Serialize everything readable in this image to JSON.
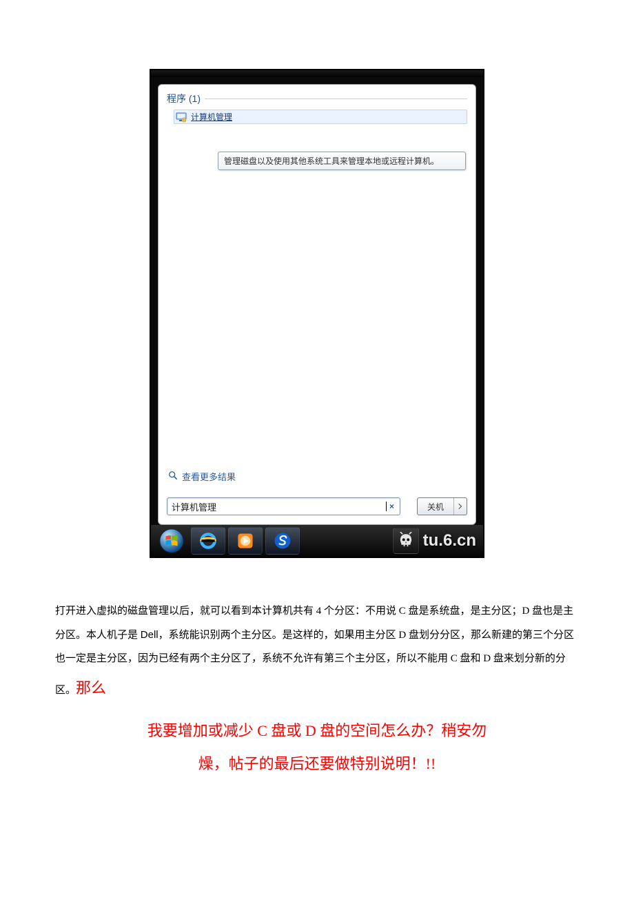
{
  "startmenu": {
    "group_label": "程序 (1)",
    "result_label": "计算机管理",
    "tooltip": "管理磁盘以及使用其他系统工具来管理本地或远程计算机。",
    "more_results": "查看更多结果",
    "search_value": "计算机管理",
    "shutdown_label": "关机"
  },
  "watermark": {
    "text": "tu.6.cn"
  },
  "para": {
    "lead": "打开进入虚拟的磁盘管理以后，就可以看到本计算机共有 4 个分区：不用说 C 盘是系统盘，是主分区；D 盘也是主分区。本人机子是 ",
    "dell": "Dell",
    "after_dell": "，系统能识别两个主分区。是这样的，如果用主分区 D 盘划分分区，那么新建的第三个分区也一定是主分区，因为已经有两个主分区了，系统不允许有第三个主分区，所以不能用 C 盘和 D 盘来划分新的分区。",
    "red_tail": "那么",
    "red_line2": "我要增加或减少 C 盘或 D 盘的空间怎么办？稍安勿",
    "red_line3": "燥，帖子的最后还要做特别说明！!!"
  }
}
